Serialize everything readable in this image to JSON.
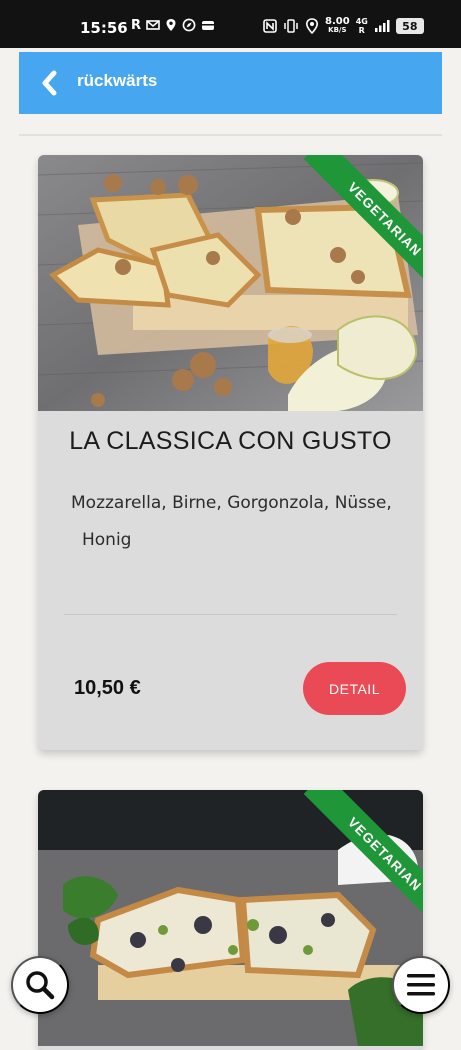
{
  "status_bar": {
    "time": "15:56",
    "left_icons": [
      "R",
      "mail-icon",
      "location-icon",
      "compass-icon",
      "wallet-icon"
    ],
    "right_icons": [
      "nfc-icon",
      "vibrate-icon",
      "location-icon"
    ],
    "net_speed_value": "8.00",
    "net_speed_unit": "KB/S",
    "network": "4G",
    "battery": "58"
  },
  "header": {
    "back_label": "rückwärts",
    "accent_color": "#46a6f0"
  },
  "products": [
    {
      "badge": "VEGETARIAN",
      "name": "LA CLASSICA CON GUSTO",
      "ingredients_line1": "Mozzarella, Birne, Gorgonzola, Nüsse,",
      "ingredients_line2": "Honig",
      "price": "10,50 €",
      "detail_label": "DETAIL"
    },
    {
      "badge": "VEGETARIAN"
    }
  ],
  "colors": {
    "detail_button": "#ea4a55",
    "vegetarian_ribbon": "#1f9638",
    "card_background": "#dcdcdc"
  },
  "fabs": {
    "search_icon": "search-icon",
    "menu_icon": "menu-icon"
  }
}
